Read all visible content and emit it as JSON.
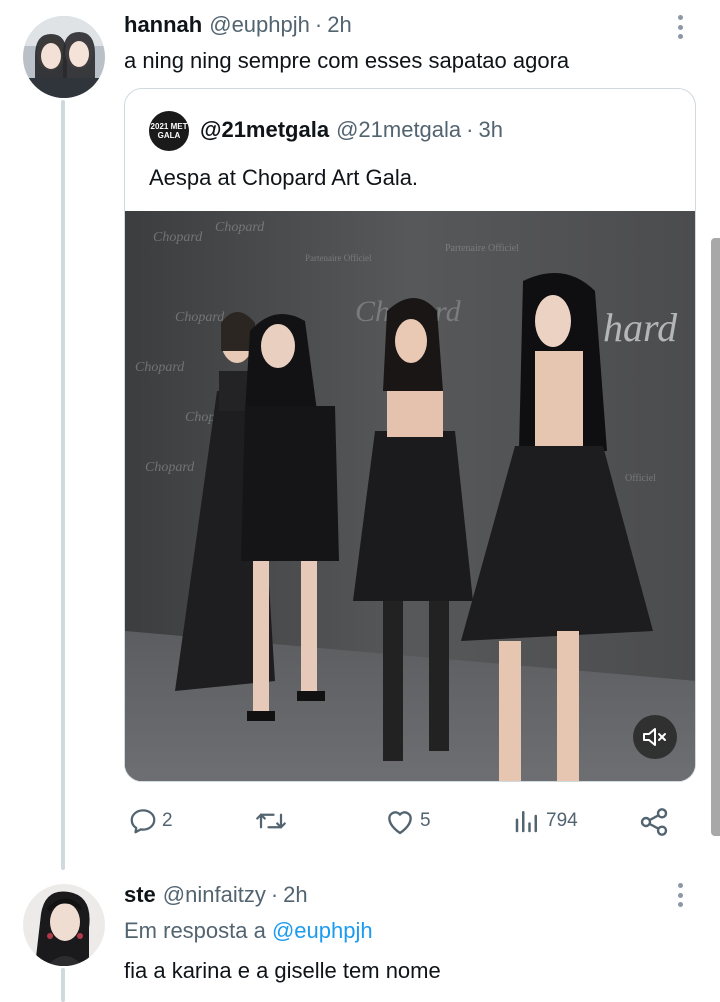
{
  "tweet1": {
    "name": "hannah",
    "handle": "@euphpjh",
    "dot": "·",
    "time": "2h",
    "text": "a ning ning sempre com esses sapatao agora",
    "avatar_icon": "profile-photo-two-people"
  },
  "quote": {
    "avatar_text": "2021 MET GALA",
    "name": "@21metgala",
    "handle": "@21metgala",
    "dot": "·",
    "time": "3h",
    "text": "Aespa at Chopard Art Gala.",
    "backdrop_text": [
      "Chopard",
      "Partenaire Officiel"
    ],
    "mute_icon": "speaker-muted-icon"
  },
  "actions": {
    "replies": "2",
    "retweets": "",
    "likes": "5",
    "views": "794"
  },
  "tweet2": {
    "name": "ste",
    "handle": "@ninfaitzy",
    "dot": "·",
    "time": "2h",
    "reply_prefix": "Em resposta a",
    "reply_mention": "@euphpjh",
    "text": "fia a karina e a giselle tem nome",
    "avatar_icon": "profile-photo-woman"
  },
  "colors": {
    "text": "#0f1419",
    "secondary": "#536471",
    "link": "#1d9bf0",
    "border": "#cfd9de"
  }
}
